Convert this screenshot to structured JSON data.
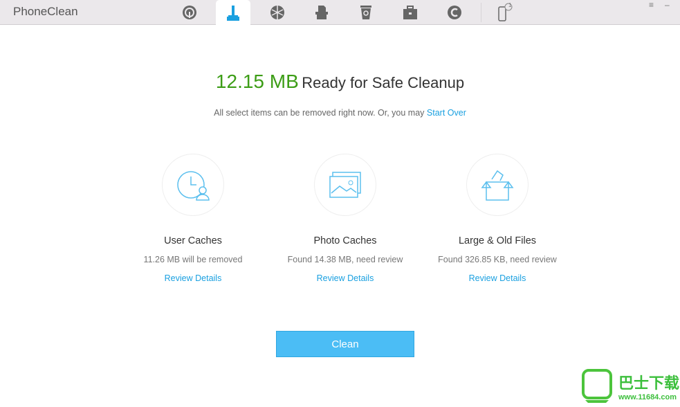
{
  "app": {
    "title": "PhoneClean"
  },
  "toolbar": {
    "tabs": [
      {
        "icon": "signal-icon"
      },
      {
        "icon": "broom-icon",
        "active": true
      },
      {
        "icon": "globe-icon"
      },
      {
        "icon": "shredder-icon"
      },
      {
        "icon": "recycle-bin-icon"
      },
      {
        "icon": "toolbox-icon"
      },
      {
        "icon": "restore-icon"
      }
    ],
    "device_badge": "1",
    "menu": "≡",
    "minimize": "–",
    "accent": "#1aa0e0"
  },
  "main": {
    "size": "12.15 MB",
    "ready": "Ready for Safe Cleanup",
    "sub": "All select items can be removed right now. Or, you may ",
    "start_over": "Start Over",
    "cards": [
      {
        "name": "User Caches",
        "desc": "11.26 MB will be removed",
        "link": "Review Details"
      },
      {
        "name": "Photo Caches",
        "desc": "Found 14.38 MB, need review",
        "link": "Review Details"
      },
      {
        "name": "Large & Old Files",
        "desc": "Found 326.85 KB, need review",
        "link": "Review Details"
      }
    ],
    "clean": "Clean"
  },
  "watermark": {
    "title": "巴士下载",
    "url": "www.11684.com"
  }
}
